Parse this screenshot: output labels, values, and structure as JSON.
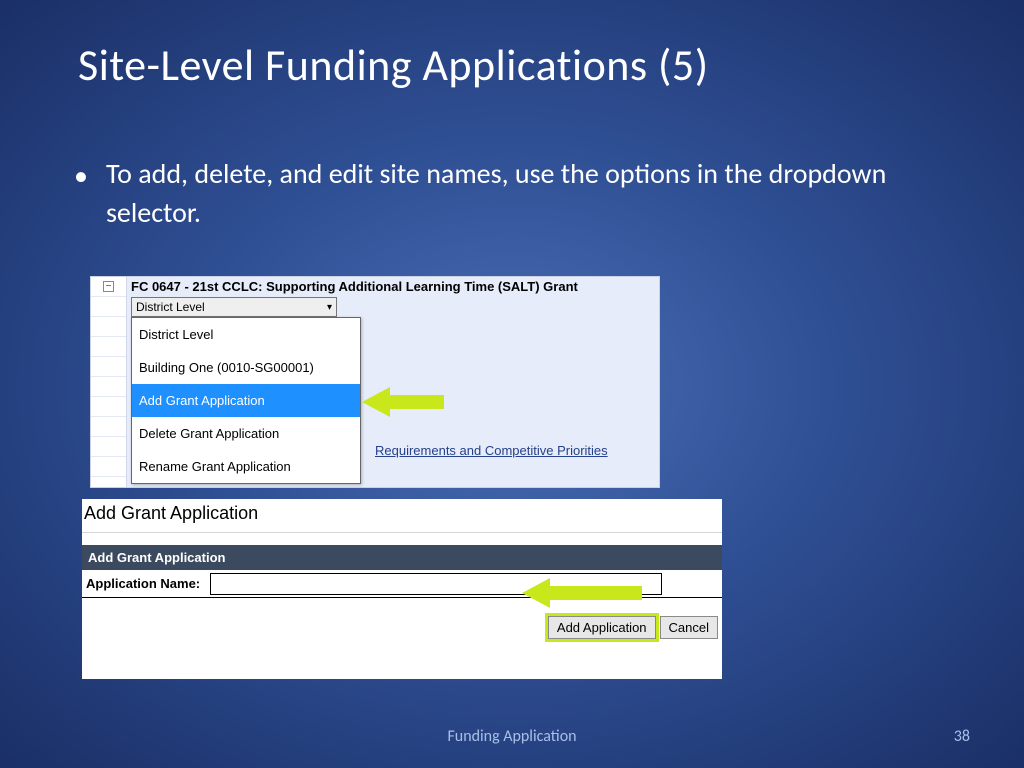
{
  "slide": {
    "title": "Site-Level Funding Applications (5)",
    "bullet": "To add, delete, and edit site names, use the options in the dropdown selector.",
    "footer_label": "Funding Application",
    "page_number": "38"
  },
  "shot1": {
    "minus": "−",
    "header": "FC 0647 - 21st CCLC: Supporting Additional Learning Time (SALT) Grant",
    "selected": "District Level",
    "chevron": "▾",
    "options": {
      "o0": "District Level",
      "o1": "Building One (0010-SG00001)",
      "o2": "Add Grant Application",
      "o3": "Delete Grant Application",
      "o4": "Rename Grant Application"
    },
    "link": "Requirements and Competitive Priorities"
  },
  "shot2": {
    "title": "Add Grant Application",
    "bar": "Add Grant Application",
    "label": "Application Name:",
    "input_value": "",
    "btn_primary": "Add Application",
    "btn_cancel": "Cancel"
  }
}
